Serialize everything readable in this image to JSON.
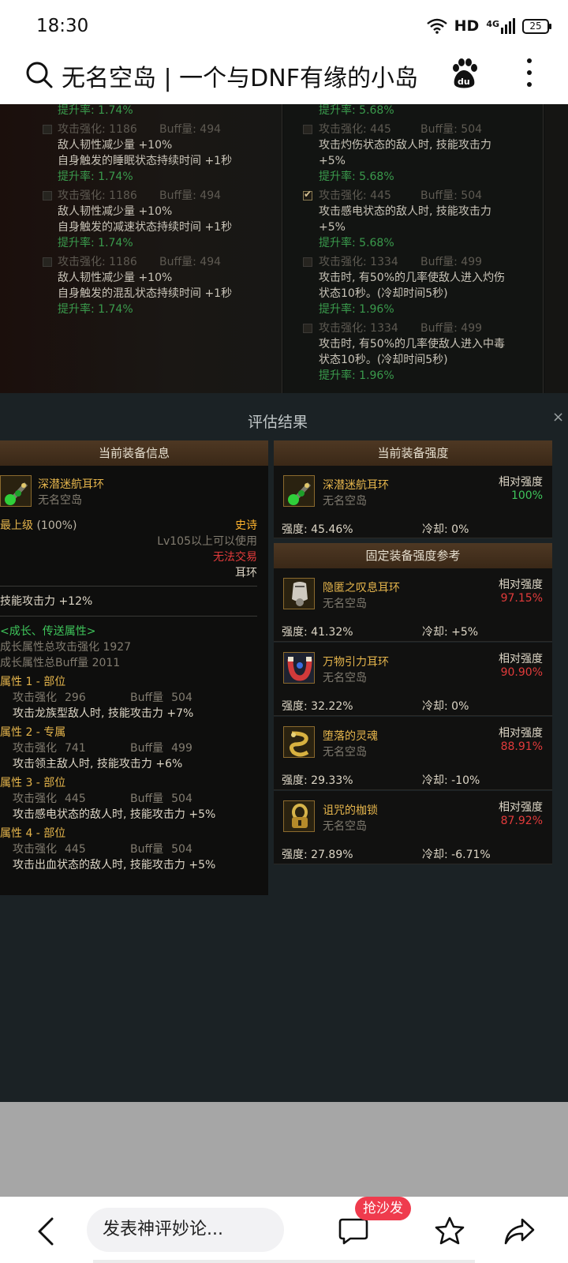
{
  "status_bar": {
    "time": "18:30",
    "network": "HD",
    "signal": "4G",
    "battery": "25"
  },
  "browser": {
    "title": "无名空岛 | 一个与DNF有缘的小岛"
  },
  "game_bg": {
    "left": [
      {
        "text": "提升率: 1.74%",
        "style": "green"
      },
      {
        "text": "攻击强化: 1186",
        "style": "dim",
        "buff": "Buff量: 494",
        "check": "off"
      },
      {
        "text": "敌人韧性减少量 +10%",
        "style": "white"
      },
      {
        "text": "自身触发的睡眠状态持续时间 +1秒",
        "style": "white"
      },
      {
        "text": "提升率: 1.74%",
        "style": "green"
      },
      {
        "text": "攻击强化: 1186",
        "style": "dim",
        "buff": "Buff量: 494",
        "check": "off"
      },
      {
        "text": "敌人韧性减少量 +10%",
        "style": "white"
      },
      {
        "text": "自身触发的减速状态持续时间 +1秒",
        "style": "white"
      },
      {
        "text": "提升率: 1.74%",
        "style": "green"
      },
      {
        "text": "攻击强化: 1186",
        "style": "dim",
        "buff": "Buff量: 494",
        "check": "off"
      },
      {
        "text": "敌人韧性减少量 +10%",
        "style": "white"
      },
      {
        "text": "自身触发的混乱状态持续时间 +1秒",
        "style": "white"
      },
      {
        "text": "提升率: 1.74%",
        "style": "green"
      }
    ],
    "right": [
      {
        "text": "提升率: 5.68%",
        "style": "green"
      },
      {
        "text": "攻击强化: 445",
        "style": "dim",
        "buff": "Buff量: 504",
        "check": "off"
      },
      {
        "text": "攻击灼伤状态的敌人时, 技能攻击力",
        "style": "white"
      },
      {
        "text": "+5%",
        "style": "white"
      },
      {
        "text": "提升率: 5.68%",
        "style": "green"
      },
      {
        "text": "攻击强化: 445",
        "style": "dim",
        "buff": "Buff量: 504",
        "check": "on"
      },
      {
        "text": "攻击感电状态的敌人时, 技能攻击力",
        "style": "white"
      },
      {
        "text": "+5%",
        "style": "white"
      },
      {
        "text": "提升率: 5.68%",
        "style": "green"
      },
      {
        "text": "攻击强化: 1334",
        "style": "dim",
        "buff": "Buff量: 499",
        "check": "off"
      },
      {
        "text": "攻击时, 有50%的几率使敌人进入灼伤",
        "style": "white"
      },
      {
        "text": "状态10秒。(冷却时间5秒)",
        "style": "white"
      },
      {
        "text": "提升率: 1.96%",
        "style": "green"
      },
      {
        "text": "攻击强化: 1334",
        "style": "dim",
        "buff": "Buff量: 499",
        "check": "off"
      },
      {
        "text": "攻击时, 有50%的几率使敌人进入中毒",
        "style": "white"
      },
      {
        "text": "状态10秒。(冷却时间5秒)",
        "style": "white"
      },
      {
        "text": "提升率: 1.96%",
        "style": "green"
      }
    ]
  },
  "modal": {
    "title": "评估结果",
    "close": "×",
    "left_panel": {
      "header": "当前装备信息",
      "item_name": "深潜迷航耳环",
      "item_sub": "无名空岛",
      "level_label": "最上级",
      "level_pct": "(100%)",
      "rarity": "史诗",
      "req": "Lv105以上可以使用",
      "trade": "无法交易",
      "slot": "耳环",
      "stat": "技能攻击力 +12%",
      "growth_title": "<成长、传送属性>",
      "growth_atk": "成长属性总攻击强化 1927",
      "growth_buff": "成长属性总Buff量 2011",
      "props": [
        {
          "title": "属性 1 - 部位",
          "atk_label": "攻击强化",
          "atk": "296",
          "buff_label": "Buff量",
          "buff": "504",
          "desc": "攻击龙族型敌人时, 技能攻击力 +7%"
        },
        {
          "title": "属性 2 - 专属",
          "atk_label": "攻击强化",
          "atk": "741",
          "buff_label": "Buff量",
          "buff": "499",
          "desc": "攻击领主敌人时, 技能攻击力 +6%"
        },
        {
          "title": "属性 3 - 部位",
          "atk_label": "攻击强化",
          "atk": "445",
          "buff_label": "Buff量",
          "buff": "504",
          "desc": "攻击感电状态的敌人时, 技能攻击力 +5%"
        },
        {
          "title": "属性 4 - 部位",
          "atk_label": "攻击强化",
          "atk": "445",
          "buff_label": "Buff量",
          "buff": "504",
          "desc": "攻击出血状态的敌人时, 技能攻击力 +5%"
        }
      ]
    },
    "current_strength": {
      "header": "当前装备强度",
      "name": "深潜迷航耳环",
      "sub": "无名空岛",
      "rel_label": "相对强度",
      "pct": "100%",
      "strength": "强度: 45.46%",
      "cooldown": "冷却: 0%"
    },
    "reference": {
      "header": "固定装备强度参考",
      "items": [
        {
          "name": "隐匿之叹息耳环",
          "sub": "无名空岛",
          "rel_label": "相对强度",
          "pct": "97.15%",
          "strength": "强度: 41.32%",
          "cooldown": "冷却: +5%",
          "icon": "bell-icon"
        },
        {
          "name": "万物引力耳环",
          "sub": "无名空岛",
          "rel_label": "相对强度",
          "pct": "90.90%",
          "strength": "强度: 32.22%",
          "cooldown": "冷却: 0%",
          "icon": "magnet-icon"
        },
        {
          "name": "堕落的灵魂",
          "sub": "无名空岛",
          "rel_label": "相对强度",
          "pct": "88.91%",
          "strength": "强度: 29.33%",
          "cooldown": "冷却: -10%",
          "icon": "serpent-icon"
        },
        {
          "name": "诅咒的枷锁",
          "sub": "无名空岛",
          "rel_label": "相对强度",
          "pct": "87.92%",
          "strength": "强度: 27.89%",
          "cooldown": "冷却: -6.71%",
          "icon": "shackle-icon"
        }
      ]
    }
  },
  "bottom_bar": {
    "comment_placeholder": "发表神评妙论...",
    "sofa_badge": "抢沙发"
  },
  "colors": {
    "accent_red": "#e23b3b",
    "accent_green": "#3ec45a",
    "gold": "#e5b54c",
    "panel_header": "#4e3823"
  }
}
